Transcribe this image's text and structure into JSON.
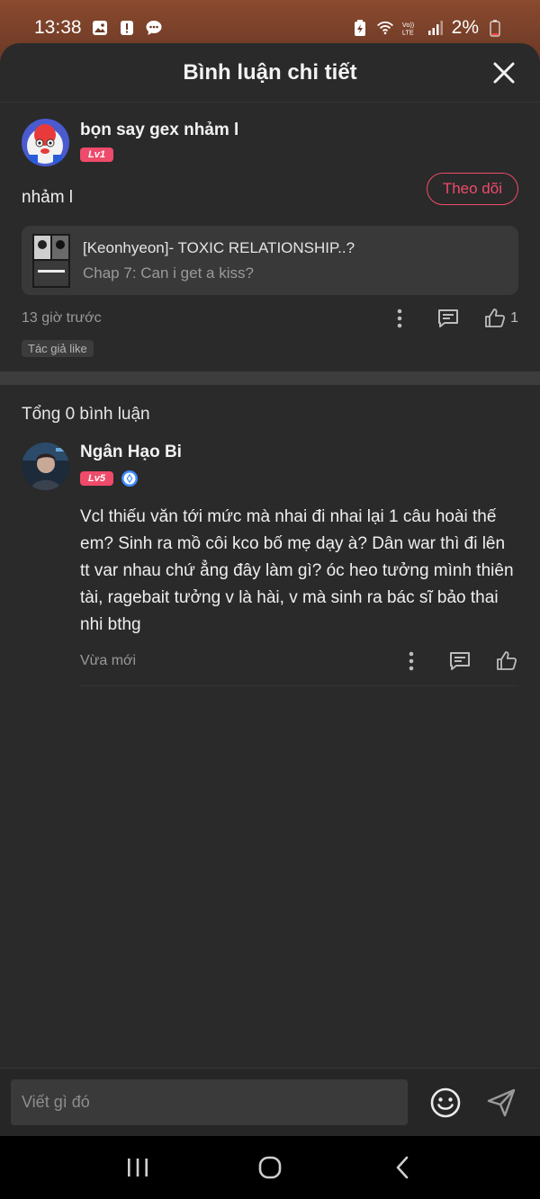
{
  "status_bar": {
    "time": "13:38",
    "battery": "2%"
  },
  "header": {
    "title": "Bình luận chi tiết"
  },
  "main_comment": {
    "username": "bọn say gex nhảm l",
    "level": "Lv1",
    "follow_label": "Theo dõi",
    "text": "nhảm l",
    "chapter": {
      "title": "[Keonhyeon]- TOXIC RELATIONSHIP..?",
      "subtitle": "Chap 7: Can i get a kiss?"
    },
    "time": "13 giờ trước",
    "like_count": "1",
    "tag": "Tác giả like"
  },
  "replies": {
    "total_label": "Tổng 0 bình luận",
    "items": [
      {
        "username": "Ngân Hạo Bi",
        "level": "Lv5",
        "text": "Vcl thiếu văn tới mức mà nhai đi nhai lại 1 câu hoài thế em? Sinh ra mồ côi kco bố mẹ dạy à? Dân war thì đi lên tt var nhau chứ ẳng đây làm gì? óc heo tưởng mình thiên tài, ragebait tưởng v là hài, v mà sinh ra bác sĩ bảo thai nhi bthg",
        "time": "Vừa mới"
      }
    ]
  },
  "input": {
    "placeholder": "Viết gì đó"
  },
  "icons": {
    "close": "close-icon",
    "more": "more-vertical-icon",
    "reply": "comment-icon",
    "like": "thumbs-up-icon",
    "emoji": "emoji-icon",
    "send": "send-icon",
    "verified": "verified-icon"
  },
  "colors": {
    "accent": "#ee4b6a",
    "background": "#2a2a2a",
    "verified": "#3d8bfd"
  }
}
